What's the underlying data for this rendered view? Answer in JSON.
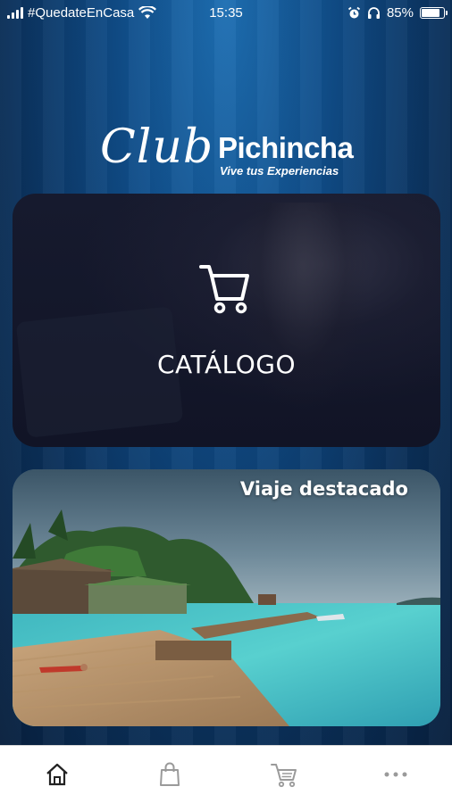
{
  "status_bar": {
    "carrier": "#QuedateEnCasa",
    "time": "15:35",
    "battery": "85%",
    "battery_level": 0.85
  },
  "logo": {
    "club": "Club",
    "brand": "Pichincha",
    "tagline": "Vive tus Experiencias"
  },
  "catalog": {
    "label": "CATÁLOGO",
    "icon": "shopping-cart-icon"
  },
  "featured": {
    "label": "Viaje destacado"
  },
  "bottom_nav": {
    "items": [
      {
        "icon": "home-icon",
        "active": true
      },
      {
        "icon": "shopping-bag-icon",
        "active": false
      },
      {
        "icon": "shopping-cart-icon",
        "active": false
      },
      {
        "icon": "more-icon",
        "active": false
      }
    ]
  },
  "colors": {
    "background_top": "#1e6fb3",
    "background_bottom": "#071f3d",
    "nav_active": "#222222",
    "nav_inactive": "#9a9a9a"
  }
}
